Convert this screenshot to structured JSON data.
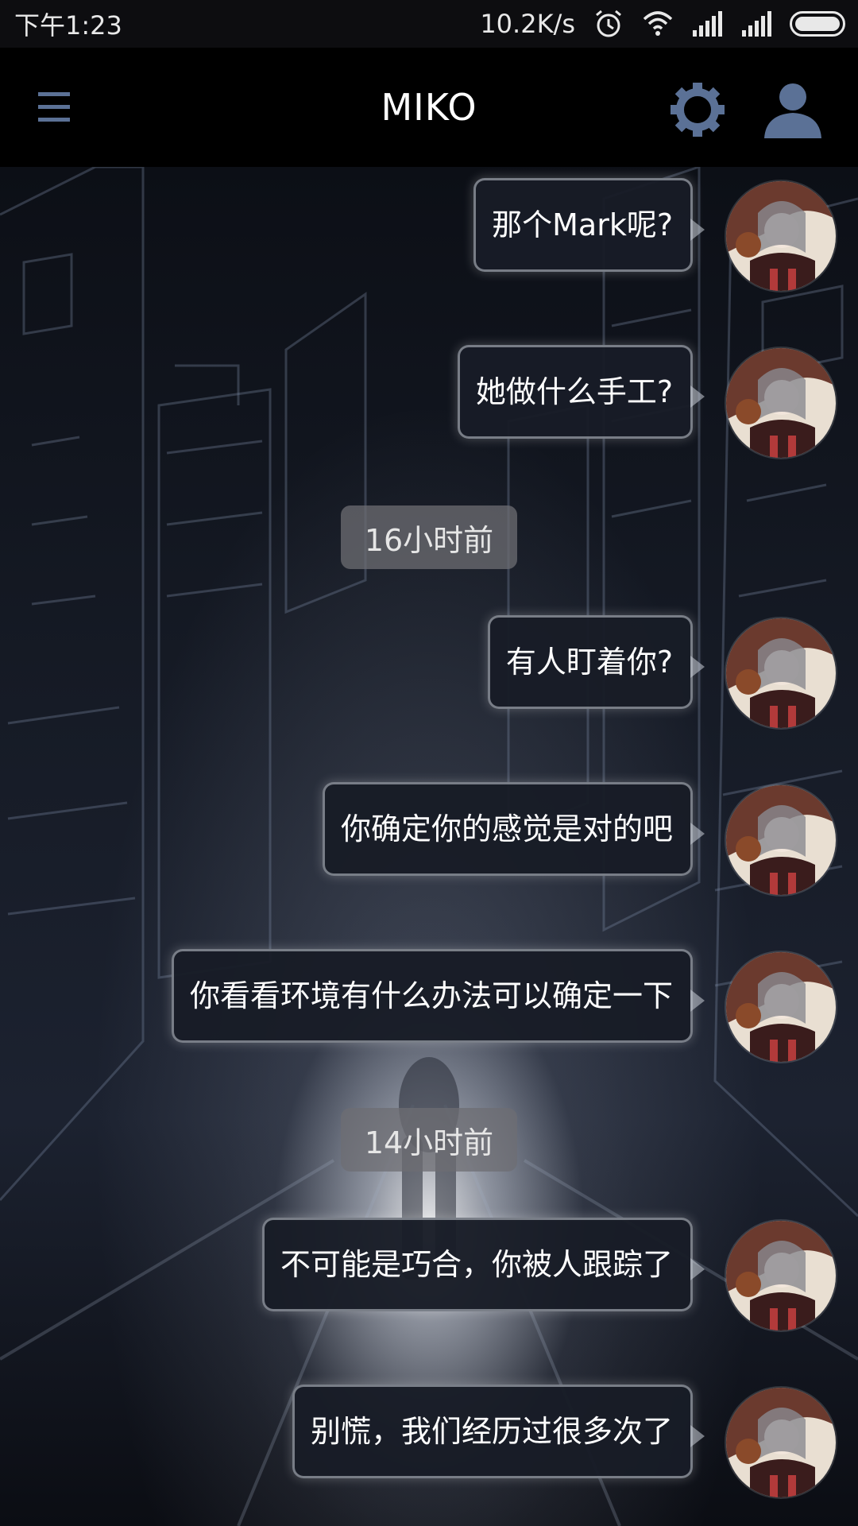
{
  "status_bar": {
    "time": "下午1:23",
    "net_speed": "10.2K/s",
    "icons": [
      "alarm-icon",
      "wifi-icon",
      "signal-icon",
      "signal-icon",
      "battery-icon"
    ]
  },
  "app_bar": {
    "title": "MIKO",
    "icons": [
      "menu-icon",
      "gear-icon",
      "profile-icon"
    ],
    "accent_color": "#5b7196"
  },
  "messages": [
    {
      "type": "message",
      "text": "那个Mark呢?"
    },
    {
      "type": "message",
      "text": "她做什么手工?"
    },
    {
      "type": "time",
      "text": "16小时前"
    },
    {
      "type": "message",
      "text": "有人盯着你?"
    },
    {
      "type": "message",
      "text": "你确定你的感觉是对的吧"
    },
    {
      "type": "message",
      "text": "你看看环境有什么办法可以确定一下"
    },
    {
      "type": "time",
      "text": "14小时前"
    },
    {
      "type": "message",
      "text": "不可能是巧合，你被人跟踪了"
    },
    {
      "type": "message",
      "text": "别慌，我们经历过很多次了"
    }
  ]
}
